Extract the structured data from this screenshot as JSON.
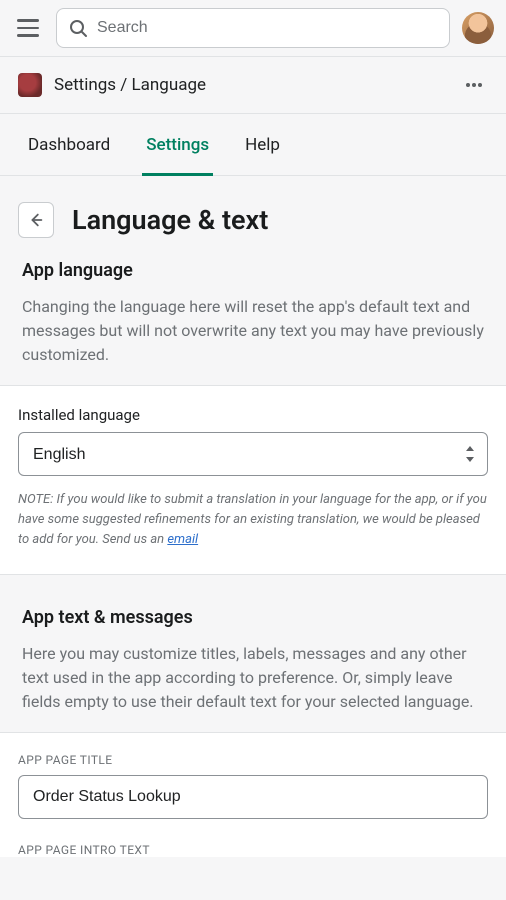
{
  "search": {
    "placeholder": "Search"
  },
  "breadcrumb": {
    "text": "Settings / Language"
  },
  "tabs": {
    "dashboard": "Dashboard",
    "settings": "Settings",
    "help": "Help"
  },
  "page": {
    "title": "Language & text"
  },
  "app_language": {
    "title": "App language",
    "desc": "Changing the language here will reset the app's default text and messages but will not overwrite any text you may have previously customized."
  },
  "installed_language": {
    "label": "Installed language",
    "value": "English",
    "note_prefix": "NOTE: If you would like to submit a translation in your language for the app, or if you have some suggested refinements for an existing translation, we would be pleased to add for you. Send us an ",
    "note_link": "email"
  },
  "app_text": {
    "title": "App text & messages",
    "desc": "Here you may customize titles, labels, messages and any other text used in the app according to preference. Or, simply leave fields empty to use their default text for your selected language."
  },
  "fields": {
    "app_page_title": {
      "label": "APP PAGE TITLE",
      "value": "Order Status Lookup"
    },
    "app_page_intro_text": {
      "label": "APP PAGE INTRO TEXT"
    }
  }
}
